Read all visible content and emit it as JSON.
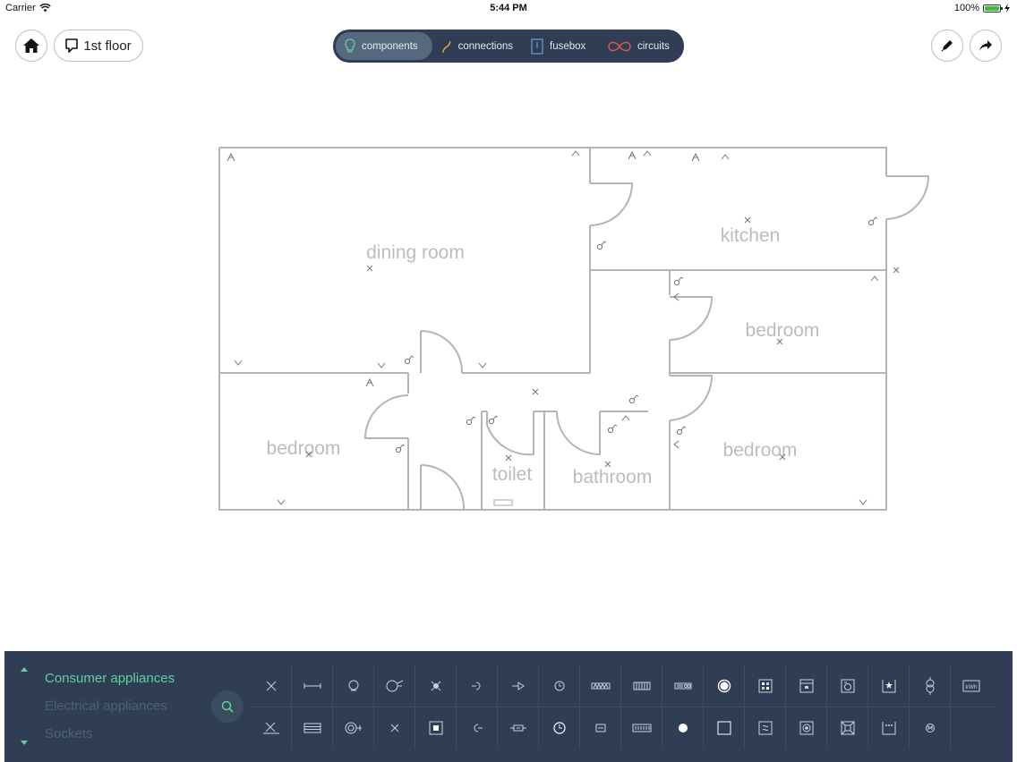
{
  "status_bar": {
    "carrier": "Carrier",
    "time": "5:44 PM",
    "battery": "100%"
  },
  "top_bar": {
    "floor_label": "1st floor",
    "modes": [
      {
        "label": "components",
        "icon": "bulb-icon",
        "active": true
      },
      {
        "label": "connections",
        "icon": "wire-icon",
        "active": false
      },
      {
        "label": "fusebox",
        "icon": "fusebox-icon",
        "active": false
      },
      {
        "label": "circuits",
        "icon": "circuit-loop-icon",
        "active": false
      }
    ]
  },
  "floor_plan": {
    "rooms": [
      "dining room",
      "kitchen",
      "bedroom",
      "bedroom",
      "bedroom",
      "toilet",
      "bathroom"
    ]
  },
  "palette": {
    "categories": [
      "Consumer appliances",
      "Electrical appliances",
      "Sockets"
    ],
    "active_category": "Consumer appliances",
    "meter_label": "kWh"
  },
  "colors": {
    "accent": "#5fcf9c",
    "panel": "#2f3e54",
    "active_segment": "#56687e"
  }
}
